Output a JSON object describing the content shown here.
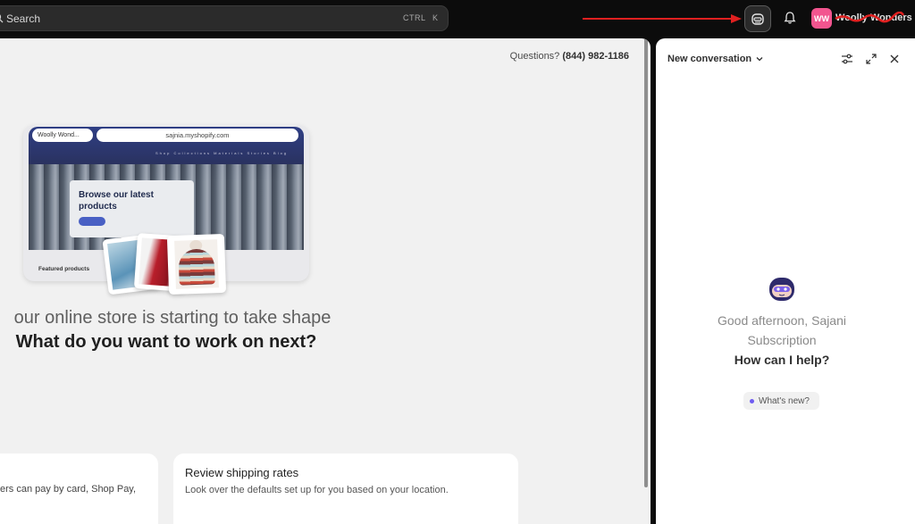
{
  "topbar": {
    "search_placeholder": "Search",
    "shortcut_ctrl": "CTRL",
    "shortcut_key": "K",
    "avatar_initials": "WW",
    "store_name": "Woolly Wonders",
    "colors": {
      "avatar": "#f2558f",
      "annotation_arrow": "#e02020"
    }
  },
  "main": {
    "questions_label": "Questions?",
    "phone": "(844) 982-1186",
    "preview": {
      "tab_label": "Woolly Wond...",
      "url": "sajnia.myshopify.com",
      "nav_items": "Shop  Collections  Materials  Stories  Blog",
      "hero_title": "Browse our latest products",
      "featured_label": "Featured products"
    },
    "headline": "our online store is starting to take shape",
    "subheadline": "What do you want to work on next?",
    "cards": [
      {
        "title": "",
        "description": "ers can pay by card, Shop Pay,"
      },
      {
        "title": "Review shipping rates",
        "description": "Look over the defaults set up for you based on your location."
      }
    ]
  },
  "assistant": {
    "title": "New conversation",
    "greeting": "Good afternoon, Sajani",
    "greeting_sub": "Subscription",
    "prompt": "How can I help?",
    "whats_new": "What's new?",
    "icons": [
      "settings-sliders-icon",
      "expand-icon",
      "close-icon"
    ]
  }
}
